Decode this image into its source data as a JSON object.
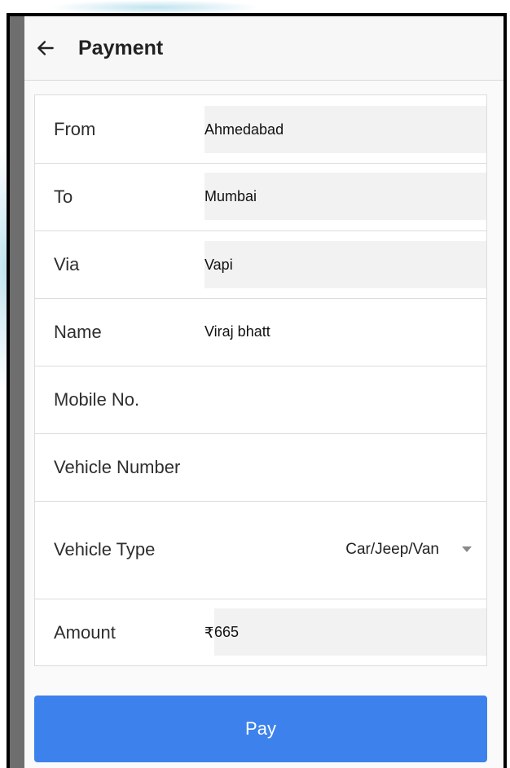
{
  "header": {
    "title": "Payment",
    "back_icon": "arrow-left-icon"
  },
  "form": {
    "from": {
      "label": "From",
      "value": "Ahmedabad"
    },
    "to": {
      "label": "To",
      "value": "Mumbai"
    },
    "via": {
      "label": "Via",
      "value": "Vapi"
    },
    "name": {
      "label": "Name",
      "value": "Viraj bhatt"
    },
    "mobile": {
      "label": "Mobile No.",
      "value": ""
    },
    "vehicle_number": {
      "label": "Vehicle Number",
      "value": ""
    },
    "vehicle_type": {
      "label": "Vehicle Type",
      "value": "Car/Jeep/Van",
      "icon": "dropdown-arrow-icon"
    },
    "amount": {
      "label": "Amount",
      "currency": "₹",
      "value": "665"
    }
  },
  "actions": {
    "pay_label": "Pay"
  },
  "colors": {
    "primary_button": "#3d82ec",
    "field_background": "#f2f2f2"
  }
}
